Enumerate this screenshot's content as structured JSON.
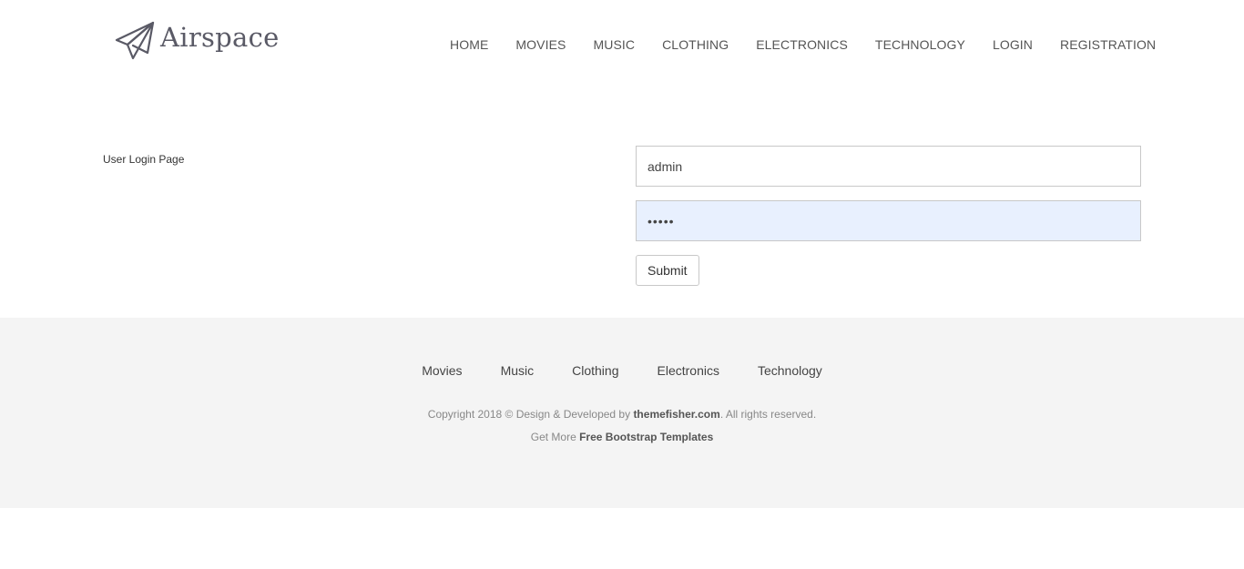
{
  "brand": {
    "name": "Airspace",
    "logo_icon": "paper-plane-icon",
    "logo_color": "#5a5a66"
  },
  "nav": {
    "items": [
      {
        "label": "HOME"
      },
      {
        "label": "MOVIES"
      },
      {
        "label": "MUSIC"
      },
      {
        "label": "CLOTHING"
      },
      {
        "label": "ELECTRONICS"
      },
      {
        "label": "TECHNOLOGY"
      },
      {
        "label": "LOGIN"
      },
      {
        "label": "REGISTRATION"
      }
    ]
  },
  "main": {
    "page_label": "User Login Page",
    "username": {
      "value": "admin"
    },
    "password": {
      "value": "admin"
    },
    "submit_label": "Submit"
  },
  "footer": {
    "links": [
      {
        "label": "Movies"
      },
      {
        "label": "Music"
      },
      {
        "label": "Clothing"
      },
      {
        "label": "Electronics"
      },
      {
        "label": "Technology"
      }
    ],
    "copyright_prefix": "Copyright 2018 © Design & Developed by ",
    "copyright_link": "themefisher.com",
    "copyright_suffix": ". All rights reserved.",
    "more_prefix": "Get More ",
    "more_link": "Free Bootstrap Templates",
    "background": "#f4f4f4"
  }
}
